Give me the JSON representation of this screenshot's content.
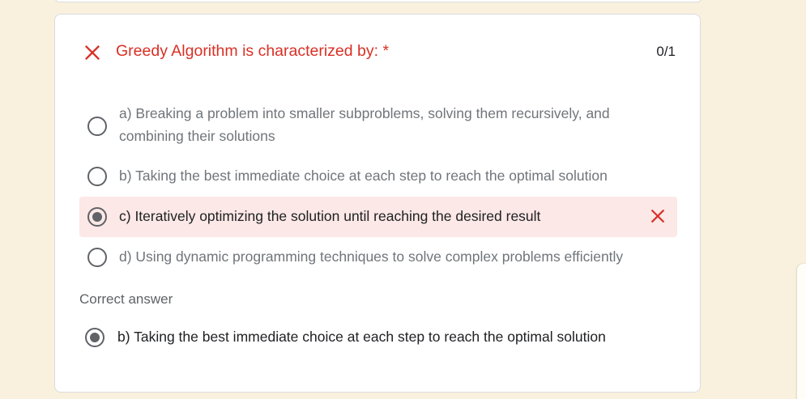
{
  "question": {
    "status_icon": "close-icon",
    "title": "Greedy Algorithm is characterized by: *",
    "score": "0/1",
    "accent_color": "#d93025",
    "options": [
      {
        "label": "a) Breaking a problem into smaller subproblems, solving them recursively, and",
        "label_line2": "combining their solutions",
        "selected": false
      },
      {
        "label": "b) Taking the best immediate choice at each step to reach the optimal solution",
        "selected": false
      },
      {
        "label": "c) Iteratively optimizing the solution until reaching the desired result",
        "selected": true,
        "marked": "incorrect",
        "mark_icon": "close-icon"
      },
      {
        "label": "d) Using dynamic programming techniques to solve complex problems efficiently",
        "selected": false
      }
    ]
  },
  "correct_answer": {
    "heading": "Correct answer",
    "label": "b) Taking the best immediate choice at each step to reach the optimal solution",
    "selected": true
  }
}
